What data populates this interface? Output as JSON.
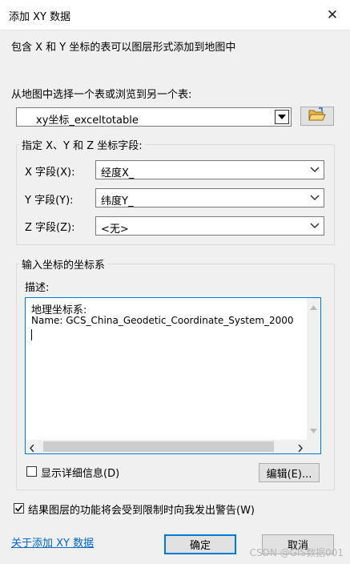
{
  "window": {
    "title": "添加 XY 数据"
  },
  "intro": "包含 X 和 Y 坐标的表可以图层形式添加到地图中",
  "table_select": {
    "label": "从地图中选择一个表或浏览到另一个表:",
    "value": "xy坐标_exceltotable"
  },
  "fields": {
    "group_label": "指定 X、Y 和 Z 坐标字段:",
    "x_label": "X 字段(X):",
    "x_value": "经度X_",
    "y_label": "Y 字段(Y):",
    "y_value": "纬度Y_",
    "z_label": "Z 字段(Z):",
    "z_value": "<无>"
  },
  "coord": {
    "group_label": "输入坐标的坐标系",
    "desc_label": "描述:",
    "line1": "地理坐标系:",
    "line2": " Name: GCS_China_Geodetic_Coordinate_System_2000",
    "show_details": "显示详细信息(D)",
    "edit_button": "编辑(E)..."
  },
  "warning_check": "结果图层的功能将会受到限制时向我发出警告(W)",
  "about_link": "关于添加 XY 数据",
  "ok_button": "确定",
  "cancel_button": "取消",
  "watermark": "CSDN @GIS数据001",
  "icons": {
    "close": "close-icon",
    "browse": "open-folder-icon",
    "dropdown": "chevron-down-icon"
  }
}
